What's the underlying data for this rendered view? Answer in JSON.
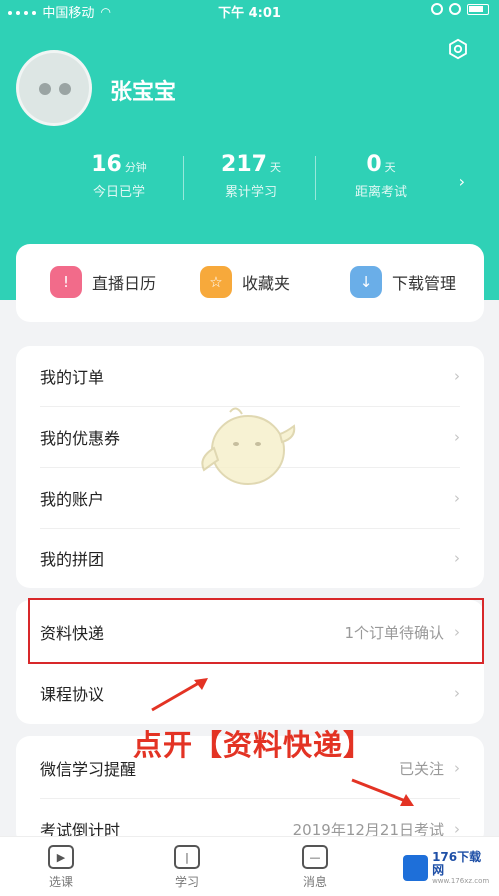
{
  "status_bar": {
    "carrier": "中国移动",
    "time": "下午 4:01"
  },
  "profile": {
    "username": "张宝宝",
    "settings_icon": "gear-icon"
  },
  "stats": [
    {
      "value": "16",
      "unit": "分钟",
      "label": "今日已学"
    },
    {
      "value": "217",
      "unit": "天",
      "label": "累计学习"
    },
    {
      "value": "0",
      "unit": "天",
      "label": "距离考试"
    }
  ],
  "quick_actions": [
    {
      "label": "直播日历",
      "icon": "calendar-icon",
      "color": "#f26b8a"
    },
    {
      "label": "收藏夹",
      "icon": "star-icon",
      "color": "#f7a93b"
    },
    {
      "label": "下载管理",
      "icon": "download-icon",
      "color": "#6aaee8"
    }
  ],
  "menu_group1": [
    {
      "label": "我的订单",
      "value": ""
    },
    {
      "label": "我的优惠券",
      "value": ""
    },
    {
      "label": "我的账户",
      "value": ""
    },
    {
      "label": "我的拼团",
      "value": ""
    }
  ],
  "menu_group2": [
    {
      "label": "资料快递",
      "value": "1个订单待确认"
    },
    {
      "label": "课程协议",
      "value": ""
    }
  ],
  "menu_group3": [
    {
      "label": "微信学习提醒",
      "value": "已关注"
    },
    {
      "label": "考试倒计时",
      "value": "2019年12月21日考试"
    }
  ],
  "annotation": "点开【资料快递】",
  "tabs": [
    {
      "label": "选课",
      "icon": "play-icon"
    },
    {
      "label": "学习",
      "icon": "book-icon"
    },
    {
      "label": "消息",
      "icon": "message-icon"
    }
  ],
  "watermark": {
    "text": "176下载网",
    "sub": "www.176xz.com"
  },
  "colors": {
    "accent": "#2fd1b6",
    "highlight": "#d8282a"
  }
}
